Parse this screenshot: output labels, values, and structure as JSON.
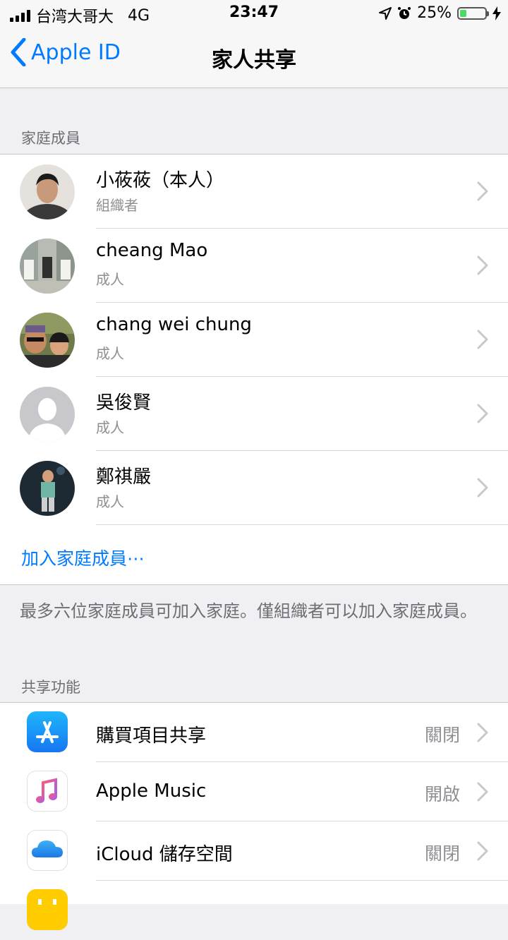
{
  "status_bar": {
    "carrier": "台湾大哥大",
    "network": "4G",
    "time": "23:47",
    "battery": "25%",
    "battery_level": 0.25
  },
  "nav": {
    "back_label": "Apple ID",
    "title": "家人共享"
  },
  "members_section": {
    "header": "家庭成員",
    "members": [
      {
        "name": "小莜莜（本人）",
        "role": "組織者"
      },
      {
        "name": "cheang Mao",
        "role": "成人"
      },
      {
        "name": "chang wei chung",
        "role": "成人"
      },
      {
        "name": "吳俊賢",
        "role": "成人"
      },
      {
        "name": "鄭祺嚴",
        "role": "成人"
      }
    ],
    "add_label": "加入家庭成員⋯"
  },
  "note": "最多六位家庭成員可加入家庭。僅組織者可以加入家庭成員。",
  "features_section": {
    "header": "共享功能",
    "items": [
      {
        "label": "購買項目共享",
        "status": "關閉",
        "icon": "app-store-icon"
      },
      {
        "label": "Apple Music",
        "status": "開啟",
        "icon": "music-icon"
      },
      {
        "label": "iCloud 儲存空間",
        "status": "關閉",
        "icon": "icloud-icon"
      }
    ]
  },
  "colors": {
    "accent": "#007aff",
    "battery_green": "#4cd964",
    "background": "#efeff4"
  }
}
